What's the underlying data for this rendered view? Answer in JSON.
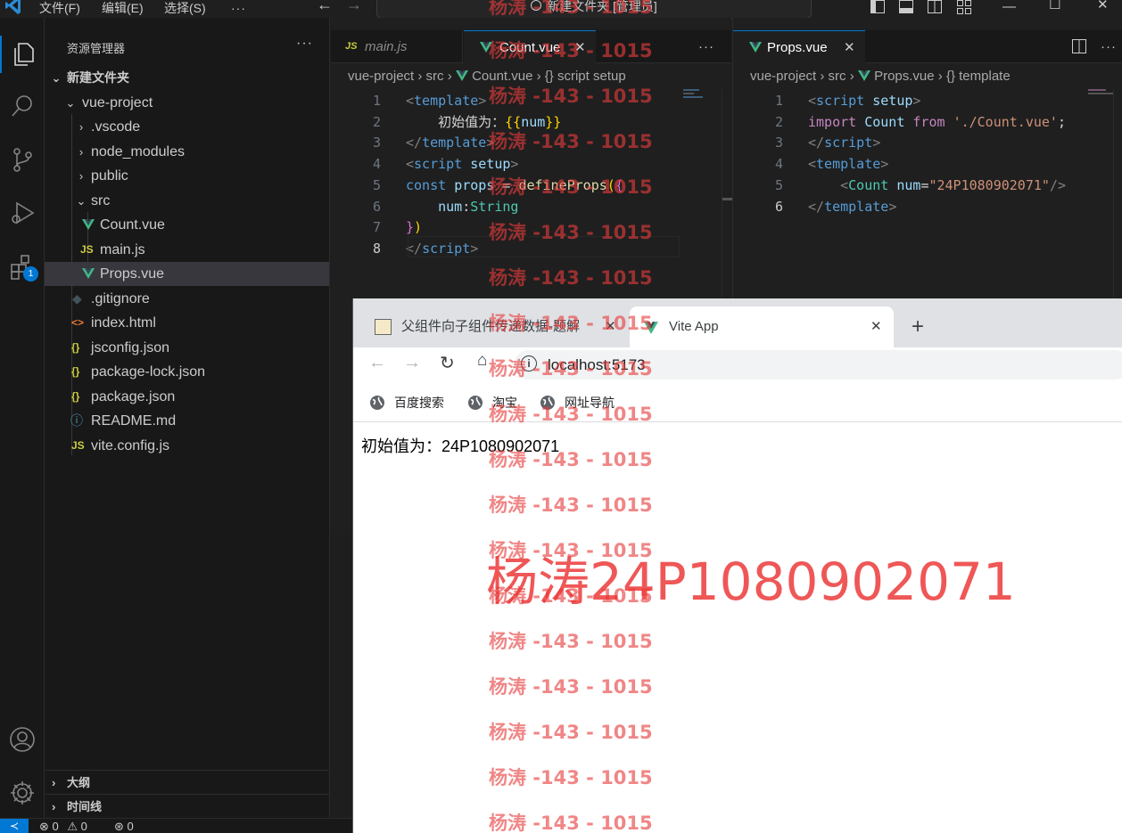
{
  "titlebar": {
    "menus": [
      "文件(F)",
      "编辑(E)",
      "选择(S)"
    ],
    "more": "···",
    "search_text": "新建文件夹 [管理员]"
  },
  "activity": {
    "extensions_badge": "1"
  },
  "sidebar": {
    "title": "资源管理器",
    "more": "···",
    "root_folder": "新建文件夹",
    "tree": [
      {
        "label": "vue-project",
        "type": "folder-open"
      },
      {
        "label": ".vscode",
        "type": "folder"
      },
      {
        "label": "node_modules",
        "type": "folder"
      },
      {
        "label": "public",
        "type": "folder"
      },
      {
        "label": "src",
        "type": "folder-open"
      },
      {
        "label": "Count.vue",
        "type": "vue"
      },
      {
        "label": "main.js",
        "type": "js",
        "icon_text": "JS"
      },
      {
        "label": "Props.vue",
        "type": "vue"
      },
      {
        "label": ".gitignore",
        "type": "git"
      },
      {
        "label": "index.html",
        "type": "html",
        "icon_text": "<>"
      },
      {
        "label": "jsconfig.json",
        "type": "json",
        "icon_text": "{}"
      },
      {
        "label": "package-lock.json",
        "type": "json",
        "icon_text": "{}"
      },
      {
        "label": "package.json",
        "type": "json",
        "icon_text": "{}"
      },
      {
        "label": "README.md",
        "type": "info",
        "icon_text": "ⓘ"
      },
      {
        "label": "vite.config.js",
        "type": "js",
        "icon_text": "JS"
      }
    ],
    "outline_label": "大纲",
    "timeline_label": "时间线"
  },
  "status": {
    "errors": "0",
    "warnings": "0",
    "ports": "0"
  },
  "editor_left": {
    "tabs": [
      {
        "label": "main.js",
        "icon_text": "JS",
        "active": false
      },
      {
        "label": "Count.vue",
        "active": true
      }
    ],
    "more": "···",
    "breadcrumb": [
      "vue-project",
      "src",
      "Count.vue",
      "{} script setup"
    ],
    "current_line": "8",
    "lines": [
      {
        "n": "1",
        "tokens": [
          [
            "<",
            "br"
          ],
          [
            "template",
            "tag"
          ],
          [
            ">",
            "br"
          ]
        ]
      },
      {
        "n": "2",
        "tokens": [
          [
            "    初始值为：",
            "plain"
          ],
          [
            "{{",
            "y"
          ],
          [
            "num",
            "attr"
          ],
          [
            "}}",
            "y"
          ]
        ]
      },
      {
        "n": "3",
        "tokens": [
          [
            "</",
            "br"
          ],
          [
            "template",
            "tag"
          ],
          [
            ">",
            "br"
          ]
        ]
      },
      {
        "n": "4",
        "tokens": [
          [
            "<",
            "br"
          ],
          [
            "script",
            "tag"
          ],
          [
            " ",
            "plain"
          ],
          [
            "setup",
            "attr"
          ],
          [
            ">",
            "br"
          ]
        ]
      },
      {
        "n": "5",
        "tokens": [
          [
            "const",
            "def"
          ],
          [
            " ",
            "plain"
          ],
          [
            "props",
            "attr"
          ],
          [
            " = ",
            "plain"
          ],
          [
            "defineProps",
            "fn"
          ],
          [
            "(",
            "y"
          ],
          [
            "{",
            "p"
          ]
        ]
      },
      {
        "n": "6",
        "tokens": [
          [
            "    ",
            "plain"
          ],
          [
            "num",
            "attr"
          ],
          [
            ":",
            "plain"
          ],
          [
            "String",
            "cls"
          ]
        ]
      },
      {
        "n": "7",
        "tokens": [
          [
            "}",
            "p"
          ],
          [
            ")",
            "y"
          ]
        ]
      },
      {
        "n": "8",
        "tokens": [
          [
            "</",
            "br"
          ],
          [
            "script",
            "tag"
          ],
          [
            ">",
            "br"
          ]
        ]
      }
    ]
  },
  "editor_right": {
    "tabs": [
      {
        "label": "Props.vue",
        "active": true
      }
    ],
    "breadcrumb": [
      "vue-project",
      "src",
      "Props.vue",
      "{} template"
    ],
    "current_line": "6",
    "lines": [
      {
        "n": "1",
        "tokens": [
          [
            "<",
            "br"
          ],
          [
            "script",
            "tag"
          ],
          [
            " ",
            "plain"
          ],
          [
            "setup",
            "attr"
          ],
          [
            ">",
            "br"
          ]
        ]
      },
      {
        "n": "2",
        "tokens": [
          [
            "import",
            "kw"
          ],
          [
            " ",
            "plain"
          ],
          [
            "Count",
            "attr"
          ],
          [
            " ",
            "plain"
          ],
          [
            "from",
            "kw"
          ],
          [
            " ",
            "plain"
          ],
          [
            "'./Count.vue'",
            "str"
          ],
          [
            ";",
            "plain"
          ]
        ]
      },
      {
        "n": "3",
        "tokens": [
          [
            "</",
            "br"
          ],
          [
            "script",
            "tag"
          ],
          [
            ">",
            "br"
          ]
        ]
      },
      {
        "n": "4",
        "tokens": [
          [
            "<",
            "br"
          ],
          [
            "template",
            "tag"
          ],
          [
            ">",
            "br"
          ]
        ]
      },
      {
        "n": "5",
        "tokens": [
          [
            "    ",
            "plain"
          ],
          [
            "<",
            "br"
          ],
          [
            "Count",
            "cls"
          ],
          [
            " ",
            "plain"
          ],
          [
            "num",
            "attr"
          ],
          [
            "=",
            "plain"
          ],
          [
            "\"24P1080902071\"",
            "str"
          ],
          [
            "/>",
            "br"
          ]
        ]
      },
      {
        "n": "6",
        "tokens": [
          [
            "</",
            "br"
          ],
          [
            "template",
            "tag"
          ],
          [
            ">",
            "br"
          ]
        ]
      }
    ]
  },
  "browser": {
    "tabs": [
      {
        "title": "父组件向子组件传递数据-题解",
        "active": false
      },
      {
        "title": "Vite App",
        "active": true
      }
    ],
    "new_tab": "+",
    "url": "localhost:5173",
    "bookmarks": [
      "百度搜索",
      "淘宝",
      "网址导航"
    ],
    "page_text": "初始值为：24P1080902071"
  },
  "watermark": {
    "small": "杨涛 -143 - 1015",
    "big": "杨涛24P1080902071"
  },
  "colors": {
    "accent": "#0078d4",
    "vue_green": "#41b883",
    "watermark_red": "#e63c3c"
  }
}
